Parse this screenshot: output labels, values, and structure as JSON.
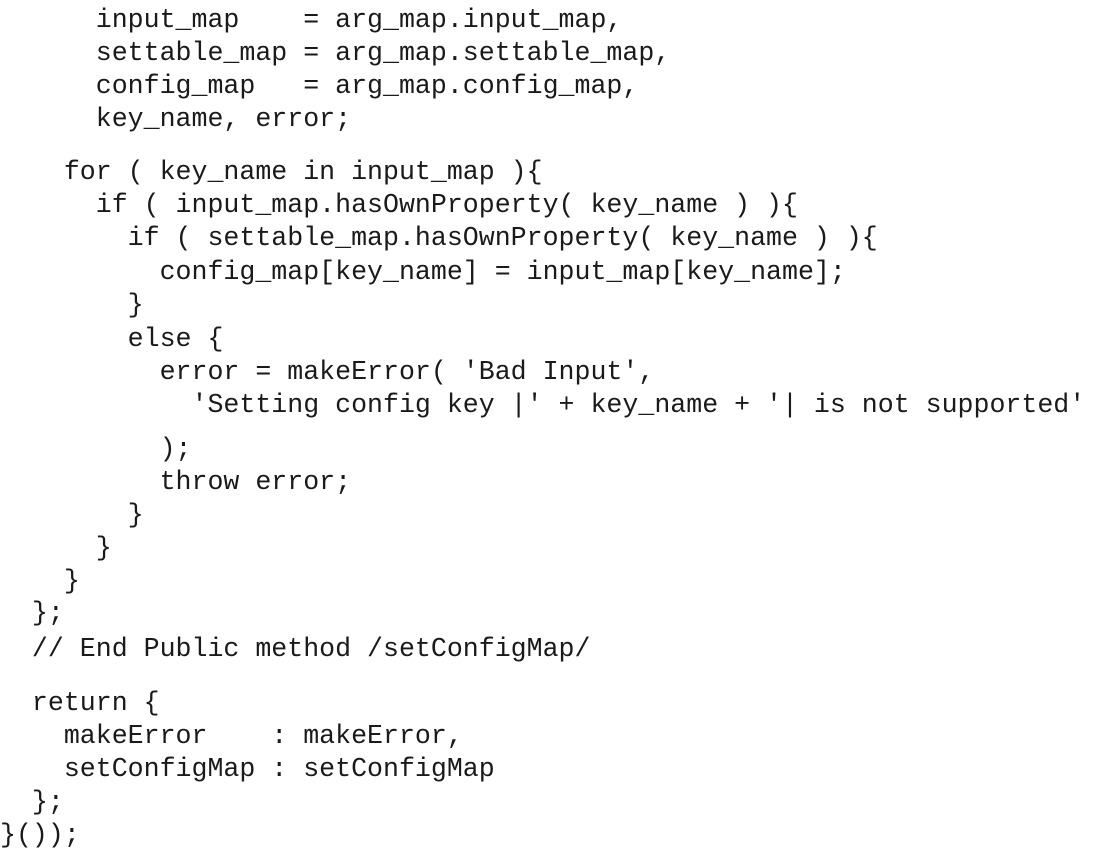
{
  "code": {
    "lines": [
      "      input_map    = arg_map.input_map,",
      "      settable_map = arg_map.settable_map,",
      "      config_map   = arg_map.config_map,",
      "      key_name, error;",
      "    for ( key_name in input_map ){",
      "      if ( input_map.hasOwnProperty( key_name ) ){",
      "        if ( settable_map.hasOwnProperty( key_name ) ){",
      "          config_map[key_name] = input_map[key_name];",
      "        }",
      "        else {",
      "          error = makeError( 'Bad Input',",
      "            'Setting config key |' + key_name + '| is not supported'",
      "          );",
      "          throw error;",
      "        }",
      "      }",
      "    }",
      "  };",
      "  // End Public method /setConfigMap/",
      "  return {",
      "    makeError    : makeError,",
      "    setConfigMap : setConfigMap",
      "  };",
      "}());"
    ]
  }
}
